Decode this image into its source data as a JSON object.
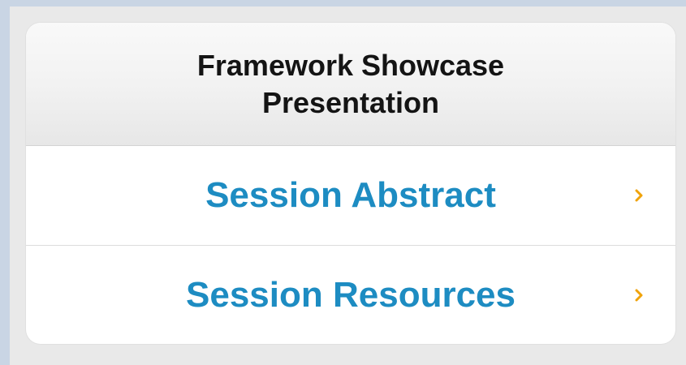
{
  "card": {
    "title": "Framework Showcase Presentation",
    "items": [
      {
        "label": "Session Abstract",
        "icon": "chevron-right-icon"
      },
      {
        "label": "Session Resources",
        "icon": "chevron-right-icon"
      }
    ]
  },
  "colors": {
    "link": "#1d8cc2",
    "chevron": "#f0a30a",
    "title": "#141414",
    "background": "#cfd9e6"
  }
}
